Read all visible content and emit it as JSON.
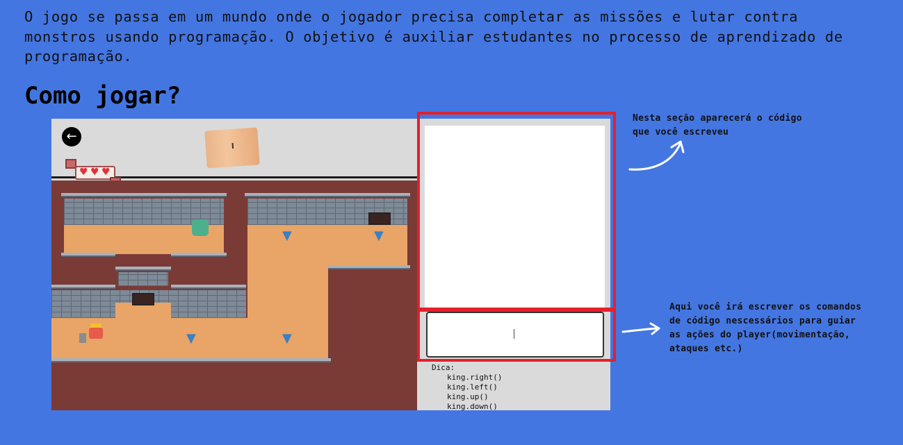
{
  "intro": {
    "line1": "O jogo se passa em um mundo onde o jogador precisa completar as missões e lutar contra",
    "line2": "monstros usando programação. O objetivo é auxiliar estudantes no processo de aprendizado de",
    "line3": "programação."
  },
  "section_title": "Como jogar?",
  "game": {
    "back_icon": "arrow-left-icon",
    "hearts": 3,
    "input_placeholder": "",
    "tips_label": "Dica:",
    "tips_commands": [
      "king.right()",
      "king.left()",
      "king.up()",
      "king.down()"
    ]
  },
  "annotations": {
    "code_view": {
      "line1": "Nesta seção aparecerá o código",
      "line2": "que você escreveu"
    },
    "command_input": {
      "line1": "Aqui você irá escrever os comandos",
      "line2": "de código nescessários para guiar",
      "line3": "as ações do player(movimentação,",
      "line4": "ataques etc.)"
    }
  },
  "colors": {
    "background": "#4476e2",
    "highlight": "#e3202b",
    "floor": "#e9a467",
    "void": "#7a3a36"
  }
}
